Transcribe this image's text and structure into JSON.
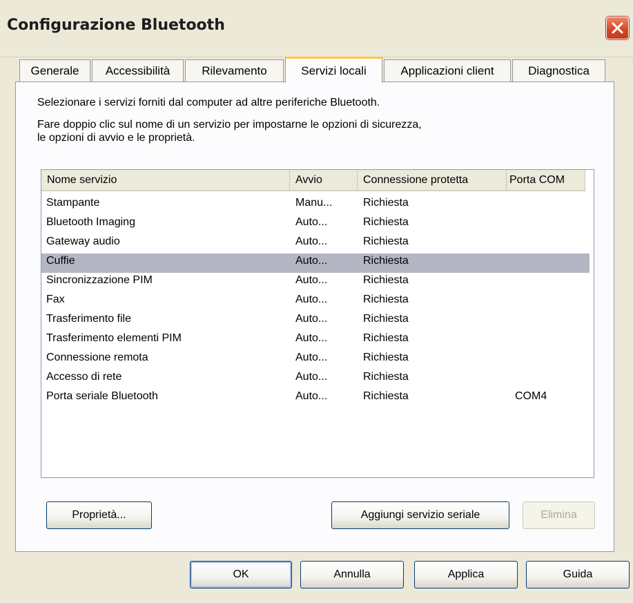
{
  "window": {
    "title": "Configurazione Bluetooth"
  },
  "tabs": [
    {
      "label": "Generale"
    },
    {
      "label": "Accessibilità"
    },
    {
      "label": "Rilevamento"
    },
    {
      "label": "Servizi locali",
      "active": true
    },
    {
      "label": "Applicazioni client"
    },
    {
      "label": "Diagnostica"
    }
  ],
  "panel": {
    "description1": "Selezionare i servizi forniti dal computer ad altre periferiche Bluetooth.",
    "description2": "Fare doppio clic sul nome di un servizio per impostarne le opzioni di sicurezza,",
    "description3": "le opzioni di avvio e le proprietà.",
    "columns": [
      "Nome servizio",
      "Avvio",
      "Connessione protetta",
      "Porta COM"
    ],
    "rows": [
      {
        "name": "Stampante",
        "avvio": "Manu...",
        "conn": "Richiesta",
        "com": ""
      },
      {
        "name": "Bluetooth Imaging",
        "avvio": "Auto...",
        "conn": "Richiesta",
        "com": ""
      },
      {
        "name": "Gateway audio",
        "avvio": "Auto...",
        "conn": "Richiesta",
        "com": ""
      },
      {
        "name": "Cuffie",
        "avvio": "Auto...",
        "conn": "Richiesta",
        "com": "",
        "selected": true
      },
      {
        "name": "Sincronizzazione PIM",
        "avvio": "Auto...",
        "conn": "Richiesta",
        "com": ""
      },
      {
        "name": "Fax",
        "avvio": "Auto...",
        "conn": "Richiesta",
        "com": ""
      },
      {
        "name": "Trasferimento file",
        "avvio": "Auto...",
        "conn": "Richiesta",
        "com": ""
      },
      {
        "name": "Trasferimento elementi PIM",
        "avvio": "Auto...",
        "conn": "Richiesta",
        "com": ""
      },
      {
        "name": "Connessione remota",
        "avvio": "Auto...",
        "conn": "Richiesta",
        "com": ""
      },
      {
        "name": "Accesso di rete",
        "avvio": "Auto...",
        "conn": "Richiesta",
        "com": ""
      },
      {
        "name": "Porta seriale Bluetooth",
        "avvio": "Auto...",
        "conn": "Richiesta",
        "com": "COM4"
      }
    ],
    "buttons": {
      "properties": "Proprietà...",
      "add_serial": "Aggiungi servizio seriale",
      "delete": "Elimina"
    }
  },
  "footer": {
    "ok": "OK",
    "cancel": "Annulla",
    "apply": "Applica",
    "help": "Guida"
  },
  "colors": {
    "selection": "#b5b6c4",
    "active_tab_accent": "#ffc83c"
  }
}
